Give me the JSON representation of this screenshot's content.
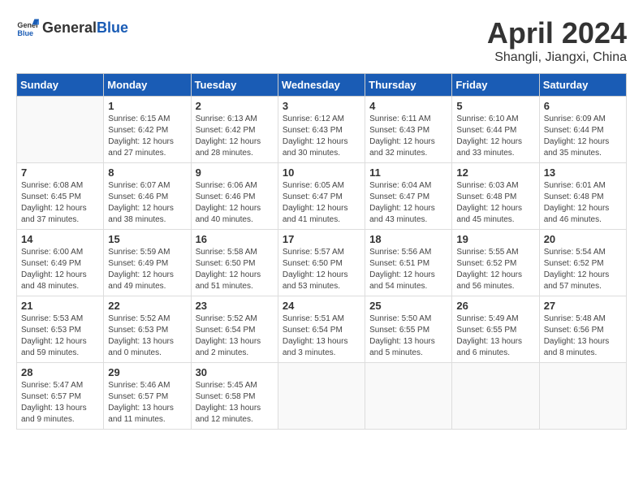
{
  "header": {
    "logo_general": "General",
    "logo_blue": "Blue",
    "month_title": "April 2024",
    "location": "Shangli, Jiangxi, China"
  },
  "days_of_week": [
    "Sunday",
    "Monday",
    "Tuesday",
    "Wednesday",
    "Thursday",
    "Friday",
    "Saturday"
  ],
  "weeks": [
    [
      {
        "day": "",
        "info": ""
      },
      {
        "day": "1",
        "info": "Sunrise: 6:15 AM\nSunset: 6:42 PM\nDaylight: 12 hours\nand 27 minutes."
      },
      {
        "day": "2",
        "info": "Sunrise: 6:13 AM\nSunset: 6:42 PM\nDaylight: 12 hours\nand 28 minutes."
      },
      {
        "day": "3",
        "info": "Sunrise: 6:12 AM\nSunset: 6:43 PM\nDaylight: 12 hours\nand 30 minutes."
      },
      {
        "day": "4",
        "info": "Sunrise: 6:11 AM\nSunset: 6:43 PM\nDaylight: 12 hours\nand 32 minutes."
      },
      {
        "day": "5",
        "info": "Sunrise: 6:10 AM\nSunset: 6:44 PM\nDaylight: 12 hours\nand 33 minutes."
      },
      {
        "day": "6",
        "info": "Sunrise: 6:09 AM\nSunset: 6:44 PM\nDaylight: 12 hours\nand 35 minutes."
      }
    ],
    [
      {
        "day": "7",
        "info": "Sunrise: 6:08 AM\nSunset: 6:45 PM\nDaylight: 12 hours\nand 37 minutes."
      },
      {
        "day": "8",
        "info": "Sunrise: 6:07 AM\nSunset: 6:46 PM\nDaylight: 12 hours\nand 38 minutes."
      },
      {
        "day": "9",
        "info": "Sunrise: 6:06 AM\nSunset: 6:46 PM\nDaylight: 12 hours\nand 40 minutes."
      },
      {
        "day": "10",
        "info": "Sunrise: 6:05 AM\nSunset: 6:47 PM\nDaylight: 12 hours\nand 41 minutes."
      },
      {
        "day": "11",
        "info": "Sunrise: 6:04 AM\nSunset: 6:47 PM\nDaylight: 12 hours\nand 43 minutes."
      },
      {
        "day": "12",
        "info": "Sunrise: 6:03 AM\nSunset: 6:48 PM\nDaylight: 12 hours\nand 45 minutes."
      },
      {
        "day": "13",
        "info": "Sunrise: 6:01 AM\nSunset: 6:48 PM\nDaylight: 12 hours\nand 46 minutes."
      }
    ],
    [
      {
        "day": "14",
        "info": "Sunrise: 6:00 AM\nSunset: 6:49 PM\nDaylight: 12 hours\nand 48 minutes."
      },
      {
        "day": "15",
        "info": "Sunrise: 5:59 AM\nSunset: 6:49 PM\nDaylight: 12 hours\nand 49 minutes."
      },
      {
        "day": "16",
        "info": "Sunrise: 5:58 AM\nSunset: 6:50 PM\nDaylight: 12 hours\nand 51 minutes."
      },
      {
        "day": "17",
        "info": "Sunrise: 5:57 AM\nSunset: 6:50 PM\nDaylight: 12 hours\nand 53 minutes."
      },
      {
        "day": "18",
        "info": "Sunrise: 5:56 AM\nSunset: 6:51 PM\nDaylight: 12 hours\nand 54 minutes."
      },
      {
        "day": "19",
        "info": "Sunrise: 5:55 AM\nSunset: 6:52 PM\nDaylight: 12 hours\nand 56 minutes."
      },
      {
        "day": "20",
        "info": "Sunrise: 5:54 AM\nSunset: 6:52 PM\nDaylight: 12 hours\nand 57 minutes."
      }
    ],
    [
      {
        "day": "21",
        "info": "Sunrise: 5:53 AM\nSunset: 6:53 PM\nDaylight: 12 hours\nand 59 minutes."
      },
      {
        "day": "22",
        "info": "Sunrise: 5:52 AM\nSunset: 6:53 PM\nDaylight: 13 hours\nand 0 minutes."
      },
      {
        "day": "23",
        "info": "Sunrise: 5:52 AM\nSunset: 6:54 PM\nDaylight: 13 hours\nand 2 minutes."
      },
      {
        "day": "24",
        "info": "Sunrise: 5:51 AM\nSunset: 6:54 PM\nDaylight: 13 hours\nand 3 minutes."
      },
      {
        "day": "25",
        "info": "Sunrise: 5:50 AM\nSunset: 6:55 PM\nDaylight: 13 hours\nand 5 minutes."
      },
      {
        "day": "26",
        "info": "Sunrise: 5:49 AM\nSunset: 6:55 PM\nDaylight: 13 hours\nand 6 minutes."
      },
      {
        "day": "27",
        "info": "Sunrise: 5:48 AM\nSunset: 6:56 PM\nDaylight: 13 hours\nand 8 minutes."
      }
    ],
    [
      {
        "day": "28",
        "info": "Sunrise: 5:47 AM\nSunset: 6:57 PM\nDaylight: 13 hours\nand 9 minutes."
      },
      {
        "day": "29",
        "info": "Sunrise: 5:46 AM\nSunset: 6:57 PM\nDaylight: 13 hours\nand 11 minutes."
      },
      {
        "day": "30",
        "info": "Sunrise: 5:45 AM\nSunset: 6:58 PM\nDaylight: 13 hours\nand 12 minutes."
      },
      {
        "day": "",
        "info": ""
      },
      {
        "day": "",
        "info": ""
      },
      {
        "day": "",
        "info": ""
      },
      {
        "day": "",
        "info": ""
      }
    ]
  ]
}
